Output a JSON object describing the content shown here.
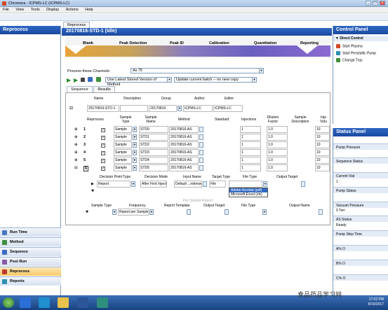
{
  "window": {
    "title": "Chromera - ICPMS-LC (ICPMS-LC)",
    "minimize": "_",
    "maximize": "□",
    "close": "x"
  },
  "menu": [
    "File",
    "View",
    "Tools",
    "Display",
    "Actions",
    "Help"
  ],
  "left_panel": {
    "title": "Reprocess",
    "nav": [
      {
        "label": "Run Time",
        "color": "#4a78c8"
      },
      {
        "label": "Method",
        "color": "#3f8f3f"
      },
      {
        "label": "Sequence",
        "color": "#3a6cc0"
      },
      {
        "label": "Post Run",
        "color": "#8a5aa8"
      },
      {
        "label": "Reprocess",
        "color": "#c0392b",
        "active": true
      },
      {
        "label": "Reports",
        "color": "#2d8fb0"
      }
    ]
  },
  "doc_tab": "Reprocess",
  "run_header": "20170816-STD-1 (Idle)",
  "workflow": {
    "stages": [
      "Blank",
      "Peak Detection",
      "Peak ID",
      "Calibration",
      "Quantitation",
      "Reporting"
    ]
  },
  "channels": {
    "label": "Process these Channels:",
    "value": "As 75"
  },
  "toolbar": {
    "method_option": "Use Latest Stored Version of Method",
    "batch_option": "Update current batch -- no new copy"
  },
  "section_tabs": [
    "Sequence",
    "Results"
  ],
  "sequence": {
    "headers": [
      "Name",
      "Description",
      "Group",
      "Author",
      "Editor"
    ],
    "row": {
      "name": "20170816-STD-1",
      "description": "",
      "group": "20170816",
      "author": "ICPMS-LC",
      "editor": "ICPMS-LC"
    }
  },
  "samples": {
    "headers": [
      "Reprocess",
      "Sample Type",
      "Sample Name",
      "Method",
      "Standard",
      "Injections",
      "Dilution Factor",
      "Sample Description",
      "Inje Volu"
    ],
    "rows": [
      {
        "num": "1",
        "type": "Sample",
        "name": "STD0",
        "method": "20170816-AS",
        "inj": "1",
        "dil": "1.0",
        "vol": "10"
      },
      {
        "num": "2",
        "type": "Sample",
        "name": "STD1",
        "method": "20170816-AS",
        "inj": "1",
        "dil": "1.0",
        "vol": "10"
      },
      {
        "num": "3",
        "type": "Sample",
        "name": "STD2",
        "method": "20170816-AS",
        "inj": "1",
        "dil": "1.0",
        "vol": "10"
      },
      {
        "num": "4",
        "type": "Sample",
        "name": "STD3",
        "method": "20170816-AS",
        "inj": "1",
        "dil": "1.0",
        "vol": "10"
      },
      {
        "num": "5",
        "type": "Sample",
        "name": "STD4",
        "method": "20170816-AS",
        "inj": "1",
        "dil": "1.0",
        "vol": "10"
      },
      {
        "num": "6",
        "type": "Sample",
        "name": "STD5",
        "method": "20170816-AS",
        "inj": "1",
        "dil": "1.0",
        "vol": "10"
      }
    ]
  },
  "report_sub": {
    "headers": [
      "Decision Point Type",
      "Decision Mode",
      "Input Name",
      "Target Type",
      "File Type",
      "Output Target"
    ],
    "row": {
      "point": "Report",
      "mode": "After First Injecti",
      "input": "Default ...ndensed",
      "target": "File",
      "file": ""
    },
    "file_options": [
      "Adobe Acrobat (pdf)",
      "Microsoft Excel (xls)"
    ]
  },
  "per_sample": {
    "label": "Per Sample Report",
    "headers": [
      "Sample Type",
      "Frequency",
      "Report Template",
      "Output Target",
      "File Type",
      "Output Name"
    ],
    "row": {
      "frequency": "Report per Sample"
    }
  },
  "control_panel": {
    "title": "Control Panel",
    "section": "Direct Control",
    "items": [
      "Start Plasma",
      "Start Peristaltic Pump",
      "Change Tray"
    ]
  },
  "status_panel": {
    "title": "Status Panel",
    "fields": [
      {
        "label": "Pump Pressure",
        "value": ""
      },
      {
        "label": "Sequence Status",
        "value": ""
      },
      {
        "label": "Current Vial",
        "value": "1"
      },
      {
        "label": "Pump Status",
        "value": ""
      },
      {
        "label": "Vacuum Pressure",
        "value": "0 Torr"
      },
      {
        "label": "AS Status",
        "value": "Ready"
      },
      {
        "label": "Pump Step Time",
        "value": ""
      },
      {
        "label": "A% O",
        "value": ""
      },
      {
        "label": "B% O",
        "value": ""
      },
      {
        "label": "C% O",
        "value": ""
      }
    ]
  },
  "taskbar": {
    "time": "17:02 PM",
    "date": "8/16/2017"
  },
  "watermark": "食品药品学习网"
}
